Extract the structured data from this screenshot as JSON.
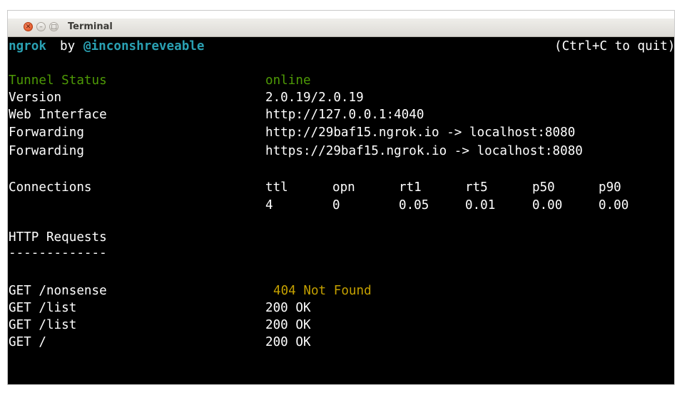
{
  "window": {
    "title": "Terminal"
  },
  "header": {
    "app": "ngrok",
    "by": "by",
    "author": "@inconshreveable",
    "quit_hint": "(Ctrl+C to quit)"
  },
  "status": [
    {
      "label": "Tunnel Status",
      "value": "online"
    },
    {
      "label": "Version",
      "value": "2.0.19/2.0.19"
    },
    {
      "label": "Web Interface",
      "value": "http://127.0.0.1:4040"
    },
    {
      "label": "Forwarding",
      "value": "http://29baf15.ngrok.io -> localhost:8080"
    },
    {
      "label": "Forwarding",
      "value": "https://29baf15.ngrok.io -> localhost:8080"
    }
  ],
  "connections": {
    "label": "Connections",
    "headers": [
      "ttl",
      "opn",
      "rt1",
      "rt5",
      "p50",
      "p90"
    ],
    "values": [
      "4",
      "0",
      "0.05",
      "0.01",
      "0.00",
      "0.00"
    ]
  },
  "http": {
    "title": "HTTP Requests",
    "underline": "-------------",
    "requests": [
      {
        "request": "GET /nonsense",
        "status": "404 Not Found"
      },
      {
        "request": "GET /list",
        "status": "200 OK"
      },
      {
        "request": "GET /list",
        "status": "200 OK"
      },
      {
        "request": "GET /",
        "status": "200 OK"
      }
    ]
  },
  "colors": {
    "terminal_bg": "#000000",
    "teal": "#2aa1b3",
    "green": "#4e9a06",
    "yellow": "#c4a000",
    "close_button": "#dd4814"
  }
}
